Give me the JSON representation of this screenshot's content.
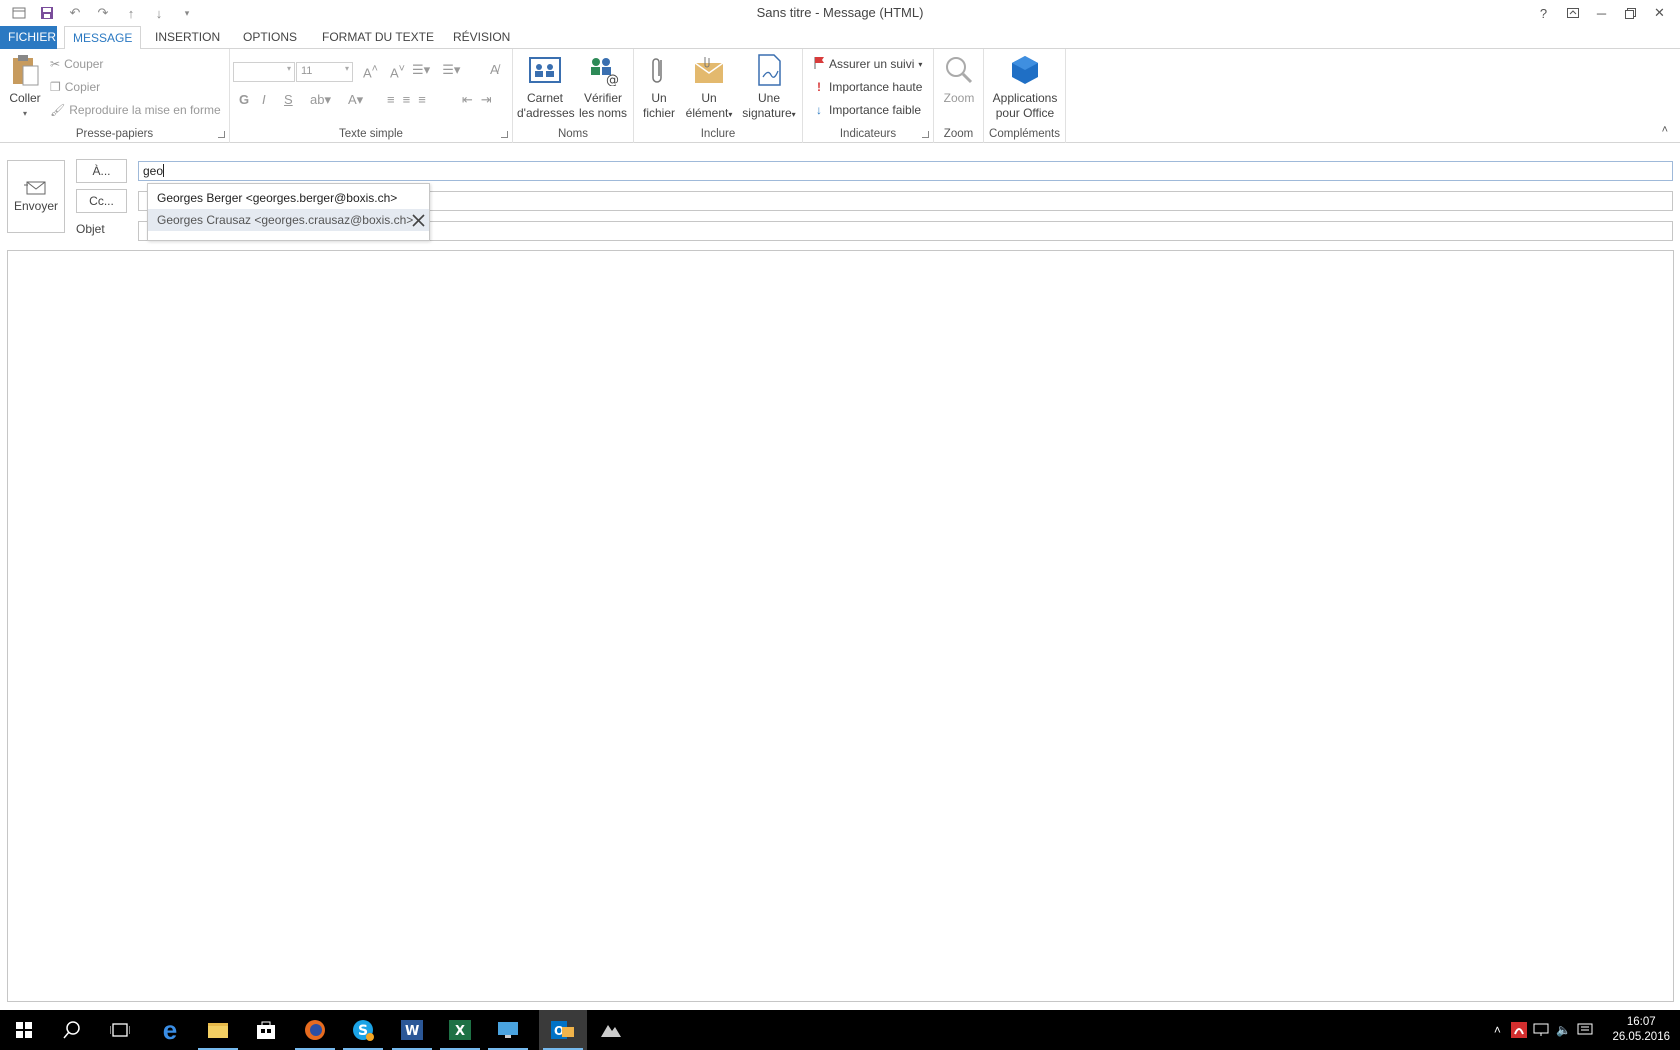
{
  "window": {
    "title": "Sans titre - Message (HTML)"
  },
  "tabs": [
    "FICHIER",
    "MESSAGE",
    "INSERTION",
    "OPTIONS",
    "FORMAT DU TEXTE",
    "RÉVISION"
  ],
  "ribbon": {
    "clipboard": {
      "paste": "Coller",
      "cut": "Couper",
      "copy": "Copier",
      "format_painter": "Reproduire la mise en forme",
      "label": "Presse-papiers"
    },
    "basic_text": {
      "font_size": "11",
      "label": "Texte simple",
      "bold": "G",
      "italic": "I",
      "underline": "S"
    },
    "names": {
      "address_book": [
        "Carnet",
        "d'adresses"
      ],
      "check_names": [
        "Vérifier",
        "les noms"
      ],
      "label": "Noms"
    },
    "include": {
      "attach_file": [
        "Un",
        "fichier"
      ],
      "attach_item": [
        "Un",
        "élément"
      ],
      "signature": [
        "Une",
        "signature"
      ],
      "label": "Inclure"
    },
    "tags": {
      "follow_up": "Assurer un suivi",
      "high_importance": "Importance haute",
      "low_importance": "Importance faible",
      "label": "Indicateurs"
    },
    "zoom": {
      "zoom": "Zoom",
      "label": "Zoom"
    },
    "addins": {
      "apps": [
        "Applications",
        "pour Office"
      ],
      "label": "Compléments"
    }
  },
  "compose": {
    "send_label": "Envoyer",
    "to_button": "À...",
    "cc_button": "Cc...",
    "subject_label": "Objet",
    "to_value": "geo",
    "autocomplete": [
      "Georges Berger <georges.berger@boxis.ch>",
      "Georges Crausaz <georges.crausaz@boxis.ch>"
    ]
  },
  "taskbar": {
    "time": "16:07",
    "date": "26.05.2016"
  },
  "colors": {
    "accent": "#2b79c2",
    "selected_suggestion": "#e5eaf1"
  }
}
